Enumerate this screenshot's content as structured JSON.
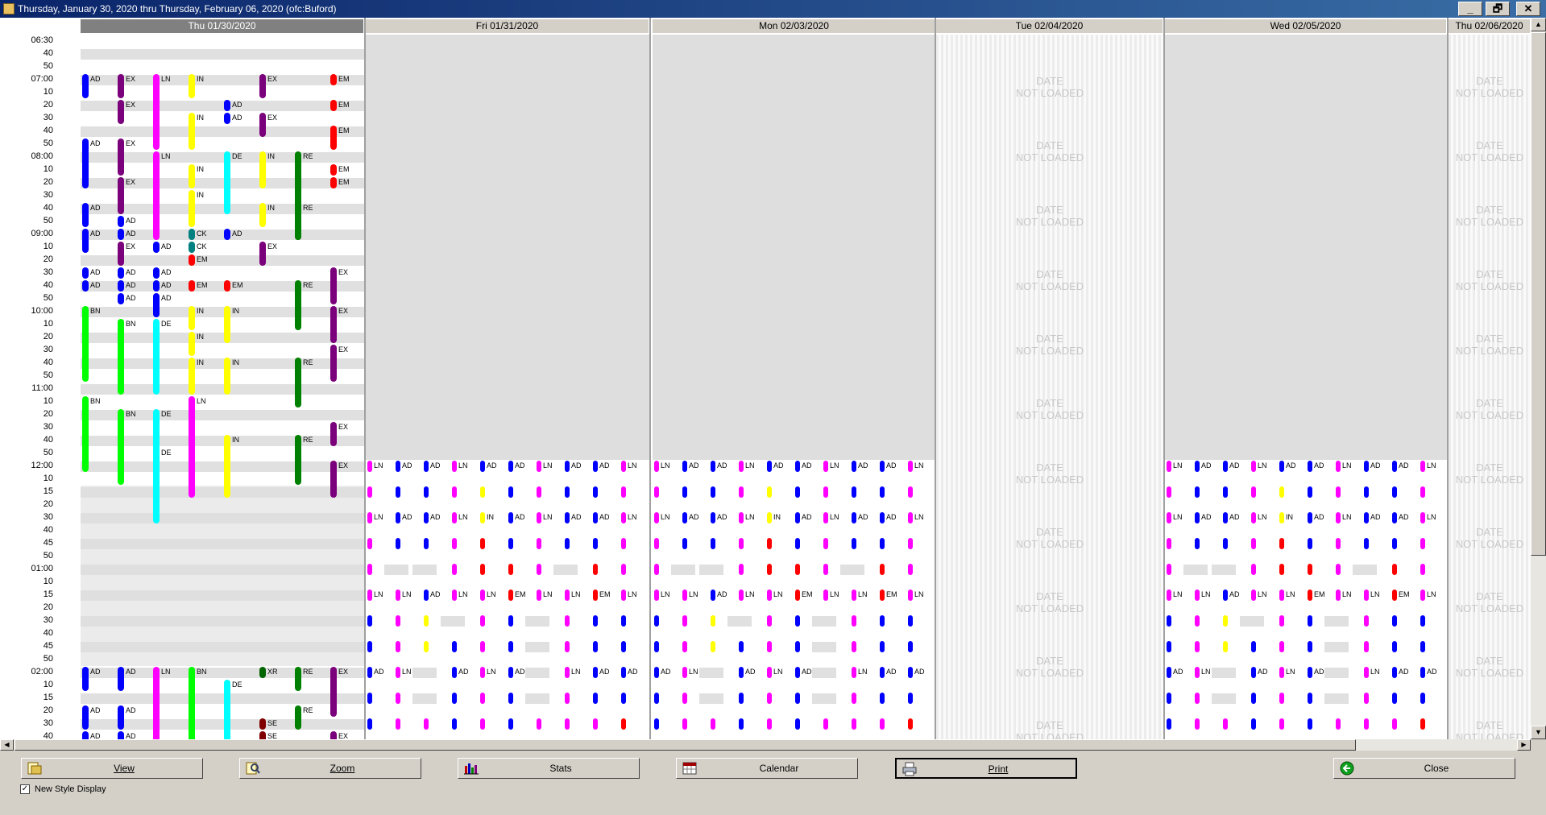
{
  "window": {
    "title": "Thursday, January 30, 2020 thru Thursday, February 06, 2020 (ofc:Buford)",
    "minimize": "_",
    "restore": "🗗",
    "close": "✕"
  },
  "colors": {
    "AD": "#0000ff",
    "EX": "#7b007b",
    "LN": "#ff00ff",
    "IN": "#ffff00",
    "DE": "#00ffff",
    "RE": "#008000",
    "EM": "#ff0000",
    "BN": "#00ff00",
    "CK": "#008080",
    "XR": "#006400",
    "SE": "#800000"
  },
  "times": [
    "06:30",
    "40",
    "50",
    "07:00",
    "10",
    "20",
    "30",
    "40",
    "50",
    "08:00",
    "10",
    "20",
    "30",
    "40",
    "50",
    "09:00",
    "10",
    "20",
    "30",
    "40",
    "50",
    "10:00",
    "10",
    "20",
    "30",
    "40",
    "50",
    "11:00",
    "10",
    "20",
    "30",
    "40",
    "50",
    "12:00",
    "10",
    "15",
    "20",
    "30",
    "40",
    "45",
    "50",
    "01:00",
    "10",
    "15",
    "20",
    "30",
    "40",
    "45",
    "50",
    "02:00",
    "10",
    "15",
    "20",
    "30",
    "40"
  ],
  "days": [
    {
      "label": "Thu 01/30/2020",
      "active": true
    },
    {
      "label": "Fri 01/31/2020"
    },
    {
      "label": "Mon 02/03/2020"
    },
    {
      "label": "Tue 02/04/2020"
    },
    {
      "label": "Wed 02/05/2020"
    },
    {
      "label": "Thu 02/06/2020"
    }
  ],
  "not_loaded": {
    "line1": "DATE",
    "line2": "NOT LOADED"
  },
  "thu_appointments": [
    [
      0,
      3,
      5,
      "AD"
    ],
    [
      0,
      8,
      12,
      "AD"
    ],
    [
      0,
      13,
      15,
      "AD"
    ],
    [
      0,
      15,
      17,
      "AD"
    ],
    [
      0,
      18,
      19,
      "AD"
    ],
    [
      0,
      19,
      20,
      "AD"
    ],
    [
      0,
      21,
      27,
      "BN"
    ],
    [
      0,
      28,
      34,
      "BN"
    ],
    [
      0,
      49,
      51,
      "AD"
    ],
    [
      0,
      52,
      54,
      "AD"
    ],
    [
      0,
      54,
      55,
      "AD"
    ],
    [
      1,
      3,
      5,
      "EX"
    ],
    [
      1,
      5,
      7,
      "EX"
    ],
    [
      1,
      8,
      11,
      "EX"
    ],
    [
      1,
      11,
      14,
      "EX"
    ],
    [
      1,
      14,
      15,
      "AD"
    ],
    [
      1,
      15,
      16,
      "AD"
    ],
    [
      1,
      16,
      18,
      "EX"
    ],
    [
      1,
      18,
      19,
      "AD"
    ],
    [
      1,
      19,
      20,
      "AD"
    ],
    [
      1,
      20,
      21,
      "AD"
    ],
    [
      1,
      22,
      28,
      "BN"
    ],
    [
      1,
      29,
      35,
      "BN"
    ],
    [
      1,
      49,
      51,
      "AD"
    ],
    [
      1,
      52,
      54,
      "AD"
    ],
    [
      1,
      54,
      55,
      "AD"
    ],
    [
      2,
      3,
      9,
      "LN"
    ],
    [
      2,
      9,
      16,
      "LN"
    ],
    [
      2,
      16,
      17,
      "AD"
    ],
    [
      2,
      18,
      19,
      "AD"
    ],
    [
      2,
      19,
      20,
      "AD"
    ],
    [
      2,
      20,
      22,
      "AD"
    ],
    [
      2,
      22,
      28,
      "DE"
    ],
    [
      2,
      29,
      33,
      "DE"
    ],
    [
      2,
      32,
      38,
      "DE"
    ],
    [
      2,
      49,
      55,
      "LN"
    ],
    [
      3,
      3,
      5,
      "IN"
    ],
    [
      3,
      6,
      9,
      "IN"
    ],
    [
      3,
      10,
      12,
      "IN"
    ],
    [
      3,
      12,
      15,
      "IN"
    ],
    [
      3,
      15,
      16,
      "CK"
    ],
    [
      3,
      16,
      17,
      "CK"
    ],
    [
      3,
      17,
      18,
      "EM"
    ],
    [
      3,
      19,
      20,
      "EM"
    ],
    [
      3,
      21,
      23,
      "IN"
    ],
    [
      3,
      23,
      25,
      "IN"
    ],
    [
      3,
      25,
      28,
      "IN"
    ],
    [
      3,
      28,
      36,
      "LN"
    ],
    [
      3,
      49,
      55,
      "BN"
    ],
    [
      4,
      5,
      6,
      "AD"
    ],
    [
      4,
      6,
      7,
      "AD"
    ],
    [
      4,
      9,
      14,
      "DE"
    ],
    [
      4,
      15,
      16,
      "AD"
    ],
    [
      4,
      19,
      20,
      "EM"
    ],
    [
      4,
      21,
      24,
      "IN"
    ],
    [
      4,
      25,
      28,
      "IN"
    ],
    [
      4,
      31,
      36,
      "IN"
    ],
    [
      4,
      50,
      55,
      "DE"
    ],
    [
      5,
      3,
      5,
      "EX"
    ],
    [
      5,
      6,
      8,
      "EX"
    ],
    [
      5,
      9,
      12,
      "IN"
    ],
    [
      5,
      13,
      15,
      "IN"
    ],
    [
      5,
      16,
      18,
      "EX"
    ],
    [
      5,
      49,
      50,
      "XR"
    ],
    [
      5,
      53,
      54,
      "SE"
    ],
    [
      5,
      54,
      55,
      "SE"
    ],
    [
      6,
      9,
      16,
      "RE"
    ],
    [
      6,
      13,
      16,
      "RE"
    ],
    [
      6,
      19,
      23,
      "RE"
    ],
    [
      6,
      25,
      29,
      "RE"
    ],
    [
      6,
      31,
      35,
      "RE"
    ],
    [
      6,
      49,
      51,
      "RE"
    ],
    [
      6,
      52,
      54,
      "RE"
    ],
    [
      7,
      3,
      4,
      "EM"
    ],
    [
      7,
      5,
      6,
      "EM"
    ],
    [
      7,
      7,
      9,
      "EM"
    ],
    [
      7,
      10,
      11,
      "EM"
    ],
    [
      7,
      11,
      12,
      "EM"
    ],
    [
      7,
      18,
      21,
      "EX"
    ],
    [
      7,
      21,
      24,
      "EX"
    ],
    [
      7,
      24,
      27,
      "EX"
    ],
    [
      7,
      30,
      32,
      "EX"
    ],
    [
      7,
      33,
      36,
      "EX"
    ],
    [
      7,
      49,
      53,
      "EX"
    ],
    [
      7,
      54,
      55,
      "EX"
    ]
  ],
  "pm_pattern": [
    [
      33,
      [
        "LN",
        "AD",
        "AD",
        "LN",
        "AD",
        "AD",
        "LN",
        "AD",
        "AD",
        "LN"
      ]
    ],
    [
      35,
      [
        "LN",
        "AD",
        "AD",
        "LN",
        "IN",
        "AD",
        "LN",
        "AD",
        "AD",
        "LN"
      ]
    ],
    [
      37,
      [
        "LN",
        "AD",
        "AD",
        "LN",
        "IN",
        "AD",
        "LN",
        "AD",
        "AD",
        "LN"
      ]
    ],
    [
      39,
      [
        "LN",
        "AD",
        "AD",
        "LN",
        "EM",
        "AD",
        "LN",
        "AD",
        "AD",
        "LN"
      ]
    ],
    [
      41,
      [
        "LN",
        "",
        "",
        "LN",
        "EM",
        "EM",
        "LN",
        "",
        "EM",
        "LN"
      ]
    ],
    [
      43,
      [
        "LN",
        "LN",
        "AD",
        "LN",
        "LN",
        "EM",
        "LN",
        "LN",
        "EM",
        "LN"
      ]
    ],
    [
      45,
      [
        "AD",
        "LN",
        "IN",
        "",
        "LN",
        "AD",
        "",
        "LN",
        "AD",
        "AD"
      ]
    ],
    [
      47,
      [
        "AD",
        "LN",
        "IN",
        "AD",
        "LN",
        "AD",
        "",
        "LN",
        "AD",
        "AD"
      ]
    ],
    [
      49,
      [
        "AD",
        "LN",
        "",
        "AD",
        "LN",
        "AD",
        "",
        "LN",
        "AD",
        "AD"
      ]
    ],
    [
      51,
      [
        "AD",
        "LN",
        "",
        "AD",
        "LN",
        "AD",
        "",
        "LN",
        "AD",
        "AD"
      ]
    ],
    [
      53,
      [
        "AD",
        "LN",
        "LN",
        "AD",
        "LN",
        "AD",
        "LN",
        "LN",
        "LN",
        "EM"
      ]
    ]
  ],
  "toolbar": {
    "view": "View",
    "zoom": "Zoom",
    "stats": "Stats",
    "calendar": "Calendar",
    "print": "Print",
    "close": "Close",
    "new_style_display": "New Style Display",
    "new_style_checked": true
  }
}
